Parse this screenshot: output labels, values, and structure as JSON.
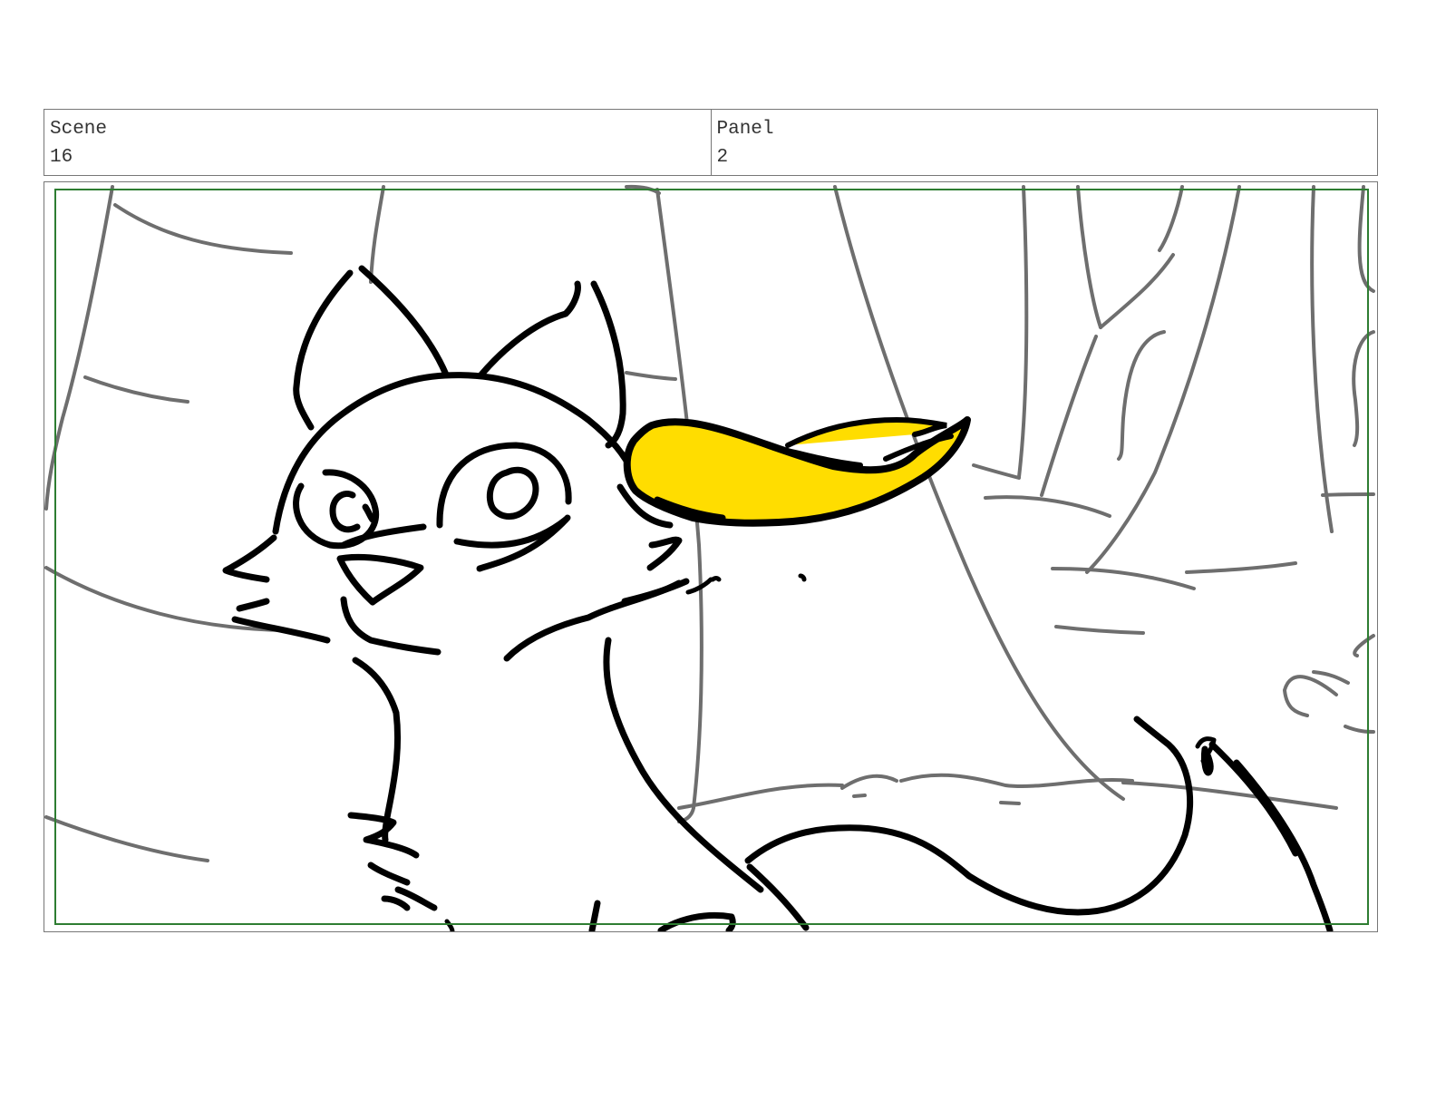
{
  "header": {
    "scene_label": "Scene",
    "scene_value": "16",
    "panel_label": "Panel",
    "panel_value": "2"
  },
  "colors": {
    "safe_area_border": "#2e7d32",
    "leaf_fill": "#ffdd00",
    "sketch_line": "#000000",
    "background_line": "#6e6e6e"
  }
}
